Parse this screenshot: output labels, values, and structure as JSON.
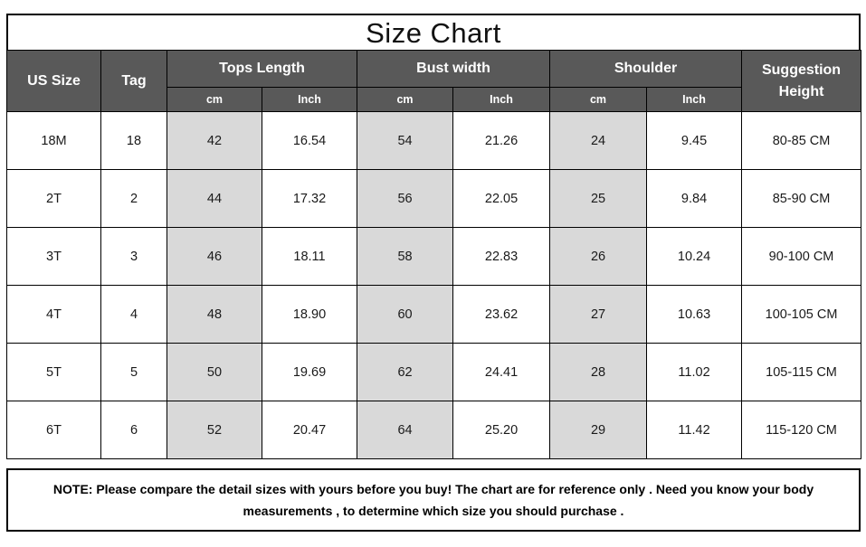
{
  "title": "Size Chart",
  "table": {
    "headers": {
      "us_size": "US Size",
      "tag": "Tag",
      "tops_length": "Tops Length",
      "bust_width": "Bust width",
      "shoulder": "Shoulder",
      "suggestion_height": "Suggestion Height",
      "sub_cm": "cm",
      "sub_inch": "Inch"
    },
    "rows": [
      {
        "us_size": "18M",
        "tag": "18",
        "tops_length_cm": "42",
        "tops_length_inch": "16.54",
        "bust_width_cm": "54",
        "bust_width_inch": "21.26",
        "shoulder_cm": "24",
        "shoulder_inch": "9.45",
        "suggestion_height": "80-85 CM"
      },
      {
        "us_size": "2T",
        "tag": "2",
        "tops_length_cm": "44",
        "tops_length_inch": "17.32",
        "bust_width_cm": "56",
        "bust_width_inch": "22.05",
        "shoulder_cm": "25",
        "shoulder_inch": "9.84",
        "suggestion_height": "85-90 CM"
      },
      {
        "us_size": "3T",
        "tag": "3",
        "tops_length_cm": "46",
        "tops_length_inch": "18.11",
        "bust_width_cm": "58",
        "bust_width_inch": "22.83",
        "shoulder_cm": "26",
        "shoulder_inch": "10.24",
        "suggestion_height": "90-100 CM"
      },
      {
        "us_size": "4T",
        "tag": "4",
        "tops_length_cm": "48",
        "tops_length_inch": "18.90",
        "bust_width_cm": "60",
        "bust_width_inch": "23.62",
        "shoulder_cm": "27",
        "shoulder_inch": "10.63",
        "suggestion_height": "100-105 CM"
      },
      {
        "us_size": "5T",
        "tag": "5",
        "tops_length_cm": "50",
        "tops_length_inch": "19.69",
        "bust_width_cm": "62",
        "bust_width_inch": "24.41",
        "shoulder_cm": "28",
        "shoulder_inch": "11.02",
        "suggestion_height": "105-115 CM"
      },
      {
        "us_size": "6T",
        "tag": "6",
        "tops_length_cm": "52",
        "tops_length_inch": "20.47",
        "bust_width_cm": "64",
        "bust_width_inch": "25.20",
        "shoulder_cm": "29",
        "shoulder_inch": "11.42",
        "suggestion_height": "115-120 CM"
      }
    ]
  },
  "note": {
    "line1": "NOTE: Please compare the detail sizes with yours before you buy! The chart are for reference only . Need you know your body",
    "line2": "measurements , to determine which size you should purchase ."
  },
  "colors": {
    "header_bg": "#595959",
    "header_text": "#ffffff",
    "shaded_cell": "#d9d9d9",
    "cell_bg": "#ffffff",
    "border": "#000000",
    "text": "#1a1a1a"
  }
}
